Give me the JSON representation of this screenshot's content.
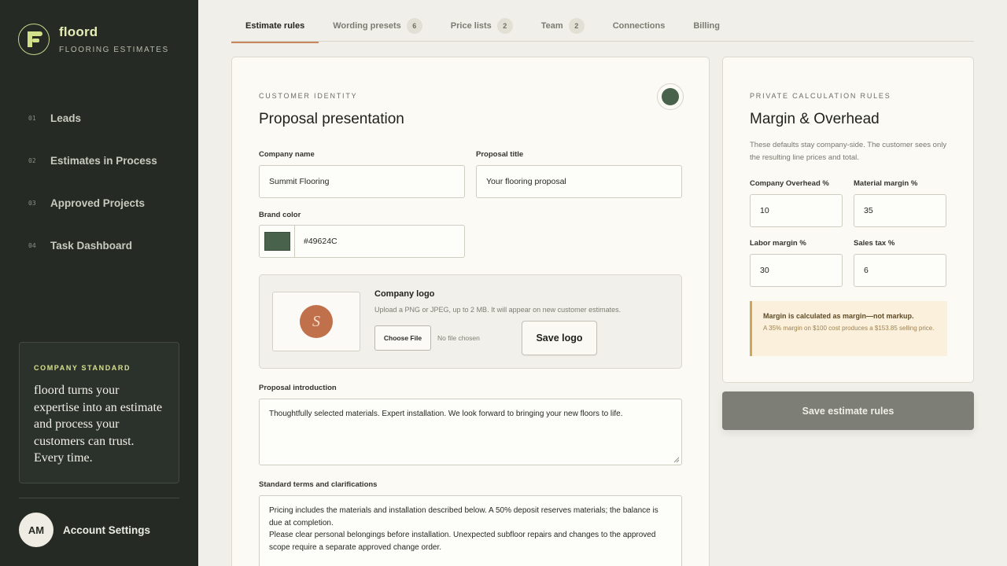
{
  "brand": {
    "name": "floord",
    "subtitle": "FLOORING ESTIMATES"
  },
  "nav": [
    {
      "num": "01",
      "label": "Leads"
    },
    {
      "num": "02",
      "label": "Estimates in Process"
    },
    {
      "num": "03",
      "label": "Approved Projects"
    },
    {
      "num": "04",
      "label": "Task Dashboard"
    }
  ],
  "standard": {
    "kicker": "COMPANY STANDARD",
    "text": "floord turns your expertise into an estimate and process your customers can trust. Every time."
  },
  "account": {
    "initials": "AM",
    "label": "Account Settings"
  },
  "tabs": [
    {
      "label": "Estimate rules",
      "badge": "",
      "active": true
    },
    {
      "label": "Wording presets",
      "badge": "6"
    },
    {
      "label": "Price lists",
      "badge": "2"
    },
    {
      "label": "Team",
      "badge": "2"
    },
    {
      "label": "Connections",
      "badge": ""
    },
    {
      "label": "Billing",
      "badge": ""
    }
  ],
  "identity": {
    "kicker": "CUSTOMER IDENTITY",
    "heading": "Proposal presentation",
    "company_name_label": "Company name",
    "company_name_value": "Summit Flooring",
    "proposal_title_label": "Proposal title",
    "proposal_title_value": "Your flooring proposal",
    "brand_color_label": "Brand color",
    "brand_color_value": "#49624C",
    "logo": {
      "initial": "S",
      "title": "Company logo",
      "help": "Upload a PNG or JPEG, up to 2 MB. It will appear on new customer estimates.",
      "choose_label": "Choose File",
      "no_file": "No file chosen",
      "save_label": "Save logo"
    },
    "intro_label": "Proposal introduction",
    "intro_value": "Thoughtfully selected materials. Expert installation. We look forward to bringing your new floors to life.",
    "terms_label": "Standard terms and clarifications",
    "terms_line1": "Pricing includes the materials and installation described below. A 50% deposit reserves materials; the balance is due at completion.",
    "terms_line2": "Please clear personal belongings before installation. Unexpected subfloor repairs and changes to the approved scope require a separate approved change order."
  },
  "rules": {
    "kicker": "PRIVATE CALCULATION RULES",
    "heading": "Margin & Overhead",
    "description": "These defaults stay company-side. The customer sees only the resulting line prices and total.",
    "overhead_label": "Company Overhead %",
    "overhead_value": "10",
    "material_label": "Material margin %",
    "material_value": "35",
    "labor_label": "Labor margin %",
    "labor_value": "30",
    "tax_label": "Sales tax %",
    "tax_value": "6",
    "note_title": "Margin is calculated as margin—not markup.",
    "note_body": "A 35% margin on $100 cost produces a $153.85 selling price.",
    "save_label": "Save estimate rules"
  },
  "colors": {
    "sidebar": "#252b24",
    "accent": "#c9875f",
    "brand_color": "#49624C",
    "logo_bg": "#c0714b"
  }
}
